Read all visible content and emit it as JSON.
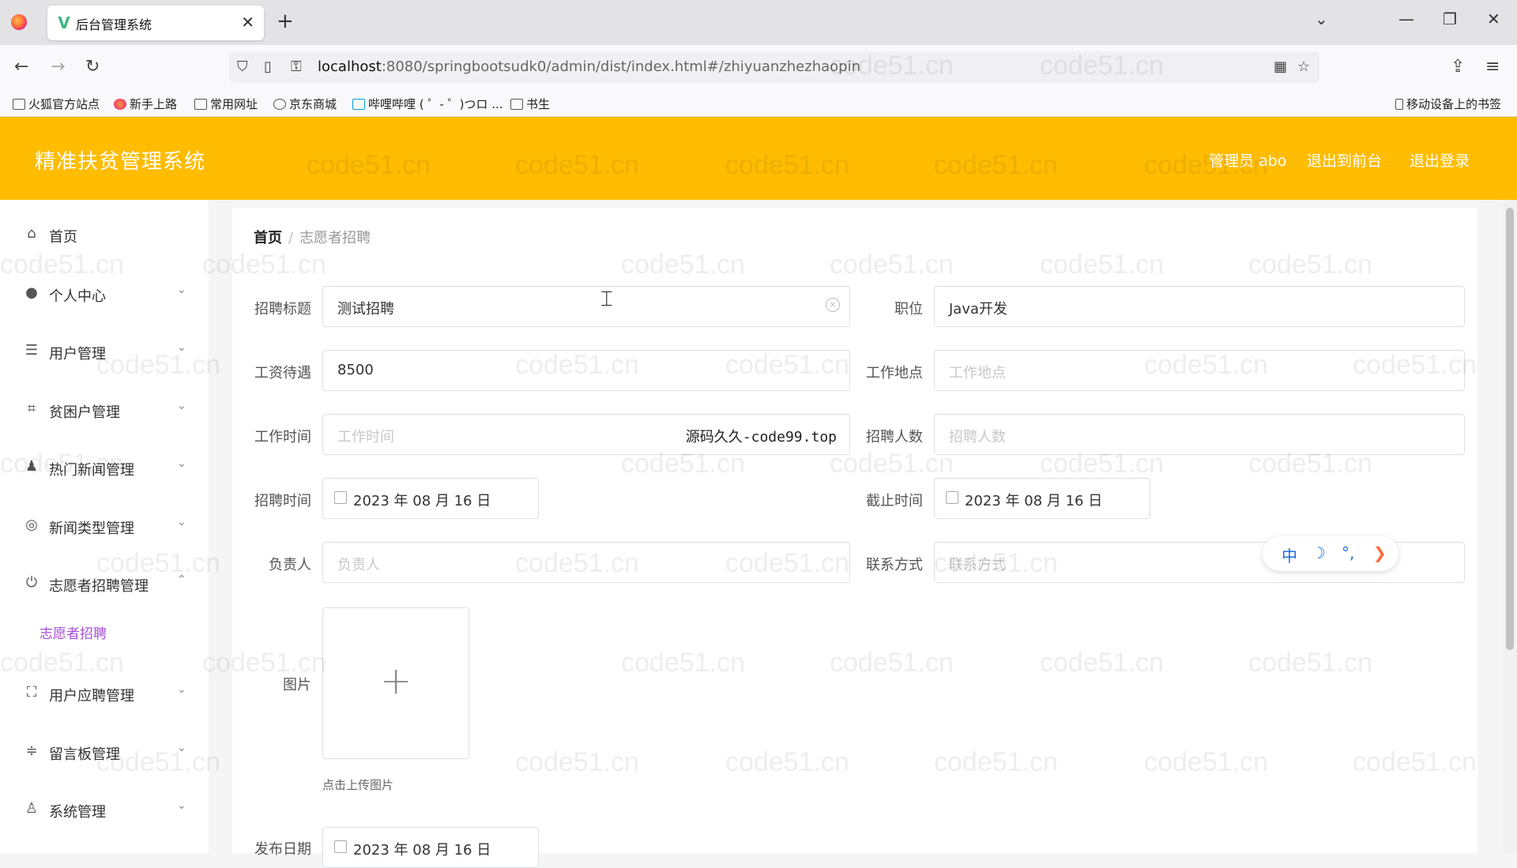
{
  "browser": {
    "tab_title": "后台管理系统",
    "url_host": "localhost",
    "url_path": ":8080/springbootsudk0/admin/dist/index.html#/zhiyuanzhezhaopin",
    "bookmarks": [
      "火狐官方站点",
      "新手上路",
      "常用网址",
      "京东商城",
      "哔哩哔哩 ( ゜- ゜)つロ ...",
      "书生"
    ],
    "mobile_bookmarks": "移动设备上的书签"
  },
  "header": {
    "title": "精准扶贫管理系统",
    "user": "管理员 abo",
    "back_front": "退出到前台",
    "logout": "退出登录",
    "color": "#ffbc00"
  },
  "sidebar": {
    "items": [
      {
        "label": "首页",
        "icon": "home-icon"
      },
      {
        "label": "个人中心",
        "icon": "user-icon"
      },
      {
        "label": "用户管理",
        "icon": "list-icon"
      },
      {
        "label": "贫困户管理",
        "icon": "crop-icon"
      },
      {
        "label": "热门新闻管理",
        "icon": "person-icon"
      },
      {
        "label": "新闻类型管理",
        "icon": "globe-icon"
      },
      {
        "label": "志愿者招聘管理",
        "icon": "power-icon"
      },
      {
        "label": "用户应聘管理",
        "icon": "frame-icon"
      },
      {
        "label": "留言板管理",
        "icon": "sliders-icon"
      },
      {
        "label": "系统管理",
        "icon": "admin-icon"
      }
    ],
    "active_sub": "志愿者招聘",
    "accent": "#a64fd8"
  },
  "breadcrumb": {
    "home": "首页",
    "current": "志愿者招聘"
  },
  "form": {
    "title_label": "招聘标题",
    "title_value": "测试招聘",
    "position_label": "职位",
    "position_value": "Java开发",
    "salary_label": "工资待遇",
    "salary_value": "8500",
    "location_label": "工作地点",
    "location_placeholder": "工作地点",
    "worktime_label": "工作时间",
    "worktime_placeholder": "工作时间",
    "headcount_label": "招聘人数",
    "headcount_placeholder": "招聘人数",
    "recruit_time_label": "招聘时间",
    "recruit_time_value": "2023 年 08 月 16 日",
    "deadline_label": "截止时间",
    "deadline_value": "2023 年 08 月 16 日",
    "manager_label": "负责人",
    "manager_placeholder": "负责人",
    "contact_label": "联系方式",
    "contact_placeholder": "联系方式",
    "image_label": "图片",
    "upload_hint": "点击上传图片",
    "publish_label": "发布日期",
    "publish_value": "2023 年 08 月 16 日"
  },
  "overlay_text": "源码久久-code99.top",
  "ime": {
    "lang": "中",
    "moon": "☽",
    "punct": "°,",
    "arrow": "❯"
  },
  "watermark": "code51.cn"
}
